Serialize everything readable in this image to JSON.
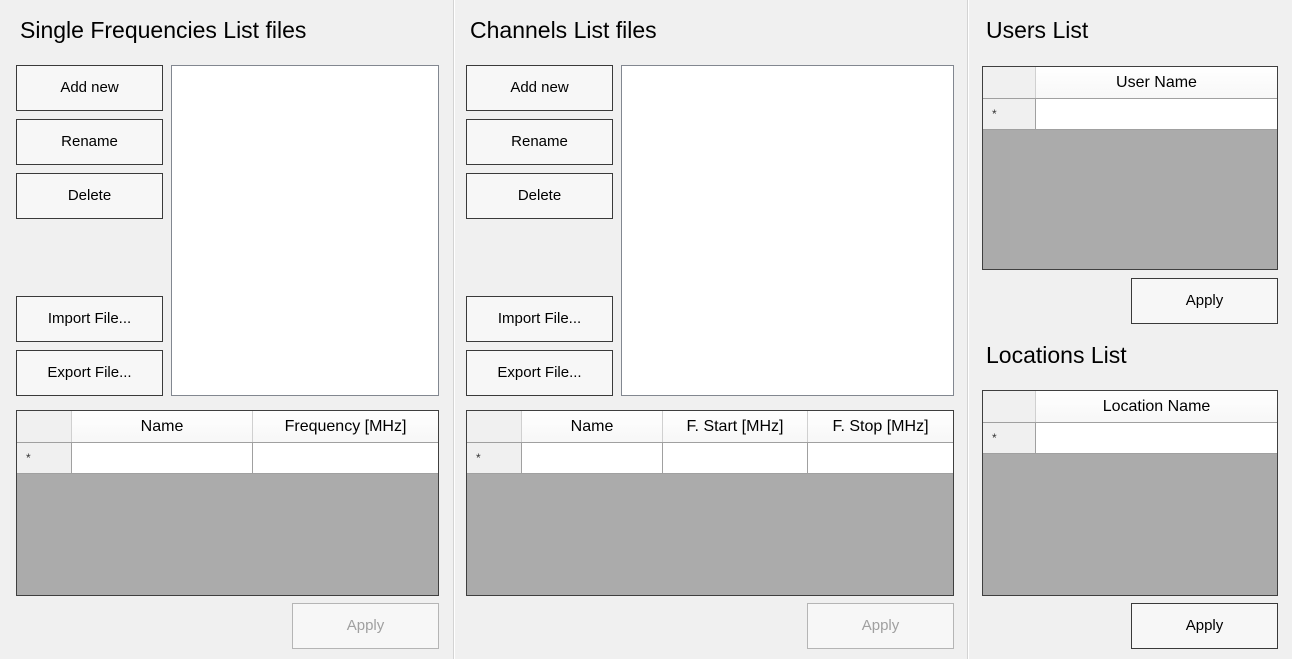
{
  "single_frequencies": {
    "title": "Single Frequencies List files",
    "buttons": {
      "add_new": "Add new",
      "rename": "Rename",
      "delete": "Delete",
      "import": "Import File...",
      "export": "Export File...",
      "apply": "Apply"
    },
    "grid": {
      "columns": [
        "Name",
        "Frequency [MHz]"
      ],
      "new_row_marker": "*"
    }
  },
  "channels": {
    "title": "Channels List files",
    "buttons": {
      "add_new": "Add new",
      "rename": "Rename",
      "delete": "Delete",
      "import": "Import File...",
      "export": "Export File...",
      "apply": "Apply"
    },
    "grid": {
      "columns": [
        "Name",
        "F. Start [MHz]",
        "F. Stop [MHz]"
      ],
      "new_row_marker": "*"
    }
  },
  "users": {
    "title": "Users List",
    "grid": {
      "columns": [
        "User Name"
      ],
      "new_row_marker": "*"
    },
    "apply": "Apply"
  },
  "locations": {
    "title": "Locations List",
    "grid": {
      "columns": [
        "Location Name"
      ],
      "new_row_marker": "*"
    },
    "apply": "Apply"
  }
}
